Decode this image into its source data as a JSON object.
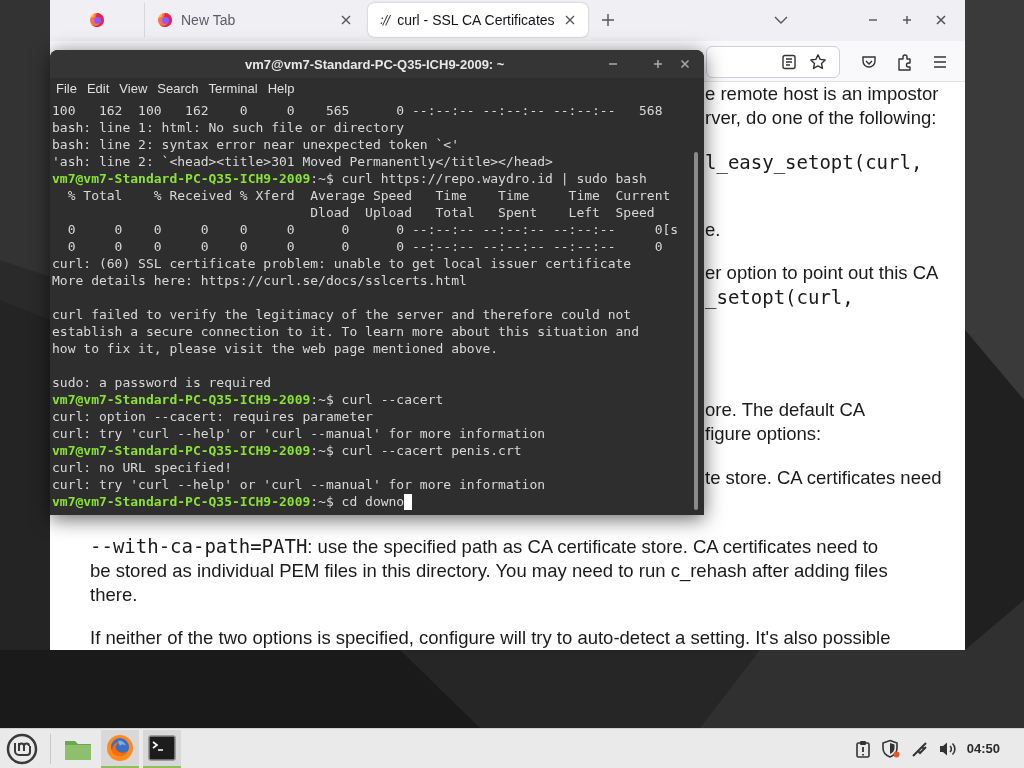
{
  "browser": {
    "tabs": [
      {
        "selected": false
      },
      {
        "label": "New Tab",
        "selected": false
      },
      {
        "label": "curl - SSL CA Certificates",
        "favicon_text": "://",
        "selected": true
      }
    ],
    "page": {
      "blocks": [
        {
          "lines": [
            {
              "kind": "text",
              "text": "e remote host is an impostor"
            },
            {
              "kind": "text",
              "text": "rver, do one of the following:"
            }
          ]
        },
        {
          "lines": [
            {
              "kind": "code",
              "text": "l_easy_setopt(curl,"
            }
          ]
        },
        {
          "lines": [
            {
              "kind": "text",
              "text": "e."
            }
          ]
        },
        {
          "lines": [
            {
              "kind": "text",
              "text": "er option to point out this CA"
            },
            {
              "kind": "code",
              "text": "_setopt(curl,"
            }
          ]
        },
        {
          "lines": [
            {
              "kind": "text",
              "text": "ore. The default CA"
            },
            {
              "kind": "text",
              "text": "figure options:"
            }
          ]
        },
        {
          "lines": [
            {
              "kind": "text",
              "text": "te store. CA certificates need"
            }
          ]
        }
      ],
      "paragraphs": [
        {
          "code": "--with-ca-path=PATH",
          "lines": [
            ": use the specified path as CA certificate store. CA certificates need to",
            "be stored as individual PEM files in this directory. You may need to run c_rehash after adding files",
            "there."
          ]
        },
        {
          "lines": [
            "If neither of the two options is specified, configure will try to auto-detect a setting. It's also possible"
          ]
        }
      ]
    }
  },
  "terminal": {
    "title": "vm7@vm7-Standard-PC-Q35-ICH9-2009: ~",
    "menu": [
      "File",
      "Edit",
      "View",
      "Search",
      "Terminal",
      "Help"
    ],
    "cursor_visible": true,
    "lines": [
      {
        "kind": "output",
        "text": "100   162  100   162    0     0    565      0 --:--:-- --:--:-- --:--:--   568"
      },
      {
        "kind": "output",
        "text": "bash: line 1: html: No such file or directory"
      },
      {
        "kind": "output",
        "text": "bash: line 2: syntax error near unexpected token `<'"
      },
      {
        "kind": "output",
        "text": "'ash: line 2: `<head><title>301 Moved Permanently</title></head>"
      },
      {
        "kind": "prompt",
        "user": "vm7@vm7-Standard-PC-Q35-ICH9-2009",
        "text": ":~$ curl https://repo.waydro.id | sudo bash"
      },
      {
        "kind": "output",
        "text": "  % Total    % Received % Xferd  Average Speed   Time    Time     Time  Current"
      },
      {
        "kind": "output",
        "text": "                                 Dload  Upload   Total   Spent    Left  Speed"
      },
      {
        "kind": "output",
        "text": "  0     0    0     0    0     0      0      0 --:--:-- --:--:-- --:--:--     0[s"
      },
      {
        "kind": "output",
        "text": "  0     0    0     0    0     0      0      0 --:--:-- --:--:-- --:--:--     0"
      },
      {
        "kind": "output",
        "text": "curl: (60) SSL certificate problem: unable to get local issuer certificate"
      },
      {
        "kind": "output",
        "text": "More details here: https://curl.se/docs/sslcerts.html"
      },
      {
        "kind": "blank"
      },
      {
        "kind": "output",
        "text": "curl failed to verify the legitimacy of the server and therefore could not"
      },
      {
        "kind": "output",
        "text": "establish a secure connection to it. To learn more about this situation and"
      },
      {
        "kind": "output",
        "text": "how to fix it, please visit the web page mentioned above."
      },
      {
        "kind": "blank"
      },
      {
        "kind": "output",
        "text": "sudo: a password is required"
      },
      {
        "kind": "prompt",
        "user": "vm7@vm7-Standard-PC-Q35-ICH9-2009",
        "text": ":~$ curl --cacert"
      },
      {
        "kind": "output",
        "text": "curl: option --cacert: requires parameter"
      },
      {
        "kind": "output",
        "text": "curl: try 'curl --help' or 'curl --manual' for more information"
      },
      {
        "kind": "prompt",
        "user": "vm7@vm7-Standard-PC-Q35-ICH9-2009",
        "text": ":~$ curl --cacert penis.crt"
      },
      {
        "kind": "output",
        "text": "curl: no URL specified!"
      },
      {
        "kind": "output",
        "text": "curl: try 'curl --help' or 'curl --manual' for more information"
      },
      {
        "kind": "prompt",
        "user": "vm7@vm7-Standard-PC-Q35-ICH9-2009",
        "text": ":~$ cd downo"
      }
    ]
  },
  "taskbar": {
    "apps": [
      {
        "kind": "folder",
        "active": false
      },
      {
        "kind": "firefox",
        "active": true
      },
      {
        "kind": "terminal",
        "active": true
      }
    ],
    "clock": "04:50"
  }
}
